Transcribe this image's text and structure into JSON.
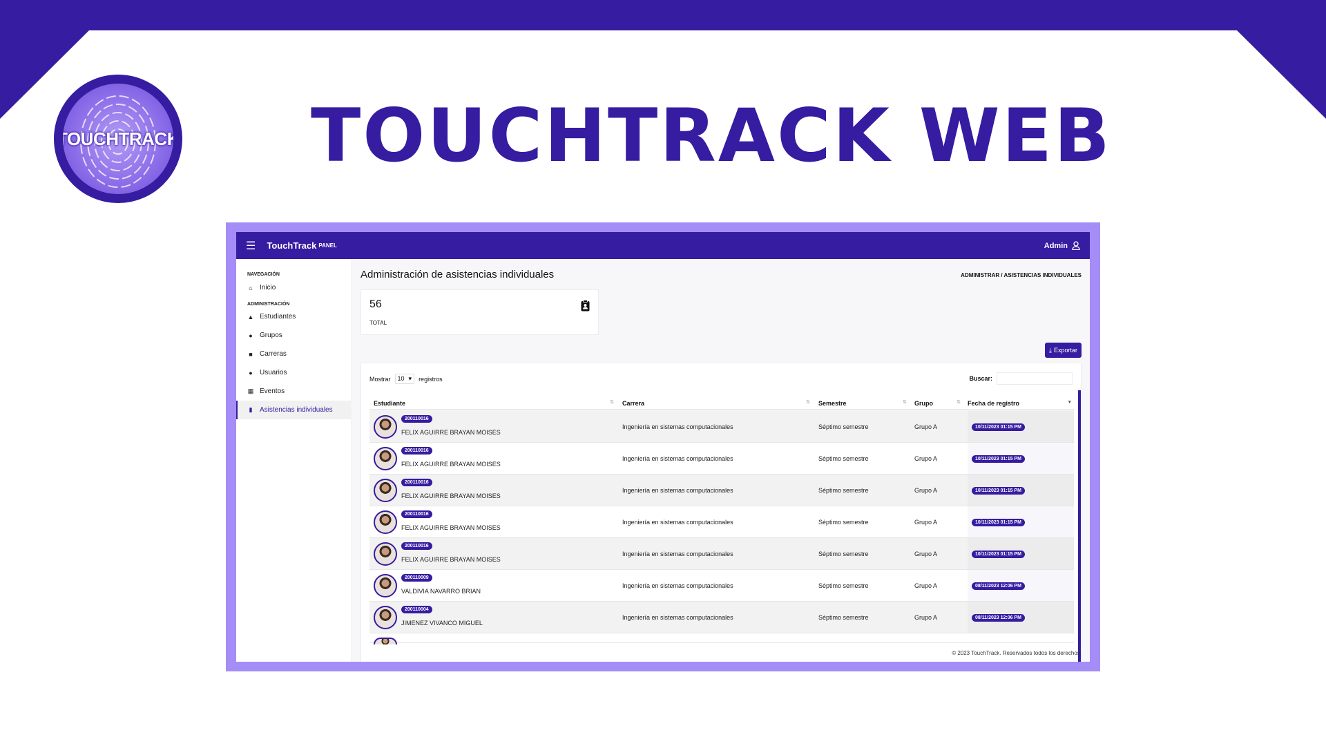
{
  "hero": {
    "title": "TOUCHTRACK WEB",
    "logo_text": "TOUCHTRACK"
  },
  "navbar": {
    "brand": "TouchTrack",
    "brand_small": "PANEL",
    "user": "Admin"
  },
  "sidebar": {
    "section_nav": "NAVEGACIÓN",
    "nav_items": [
      {
        "label": "Inicio",
        "icon": "home-icon"
      }
    ],
    "section_admin": "ADMINISTRACIÓN",
    "admin_items": [
      {
        "label": "Estudiantes",
        "icon": "graduation-cap-icon"
      },
      {
        "label": "Grupos",
        "icon": "people-group-icon"
      },
      {
        "label": "Carreras",
        "icon": "building-icon"
      },
      {
        "label": "Usuarios",
        "icon": "users-icon"
      },
      {
        "label": "Eventos",
        "icon": "calendar-icon"
      },
      {
        "label": "Asistencias individuales",
        "icon": "clipboard-user-icon",
        "active": true
      }
    ]
  },
  "main": {
    "title": "Administración de asistencias individuales",
    "breadcrumb": "ADMINISTRAR / ASISTENCIAS INDIVIDUALES",
    "stat": {
      "value": "56",
      "label": "TOTAL"
    },
    "export_label": "Exportar",
    "table": {
      "show_label": "Mostrar",
      "show_value": "10",
      "records_label": "registros",
      "search_label": "Buscar:",
      "columns": [
        "Estudiante",
        "Carrera",
        "Semestre",
        "Grupo",
        "Fecha de registro"
      ],
      "rows": [
        {
          "id": "200110016",
          "name": "FELIX AGUIRRE BRAYAN MOISES",
          "carrera": "Ingeniería en sistemas computacionales",
          "semestre": "Séptimo semestre",
          "grupo": "Grupo A",
          "fecha": "10/11/2023 01:15 PM"
        },
        {
          "id": "200110016",
          "name": "FELIX AGUIRRE BRAYAN MOISES",
          "carrera": "Ingeniería en sistemas computacionales",
          "semestre": "Séptimo semestre",
          "grupo": "Grupo A",
          "fecha": "10/11/2023 01:15 PM"
        },
        {
          "id": "200110016",
          "name": "FELIX AGUIRRE BRAYAN MOISES",
          "carrera": "Ingeniería en sistemas computacionales",
          "semestre": "Séptimo semestre",
          "grupo": "Grupo A",
          "fecha": "10/11/2023 01:15 PM"
        },
        {
          "id": "200110016",
          "name": "FELIX AGUIRRE BRAYAN MOISES",
          "carrera": "Ingeniería en sistemas computacionales",
          "semestre": "Séptimo semestre",
          "grupo": "Grupo A",
          "fecha": "10/11/2023 01:15 PM"
        },
        {
          "id": "200110016",
          "name": "FELIX AGUIRRE BRAYAN MOISES",
          "carrera": "Ingeniería en sistemas computacionales",
          "semestre": "Séptimo semestre",
          "grupo": "Grupo A",
          "fecha": "10/11/2023 01:15 PM"
        },
        {
          "id": "200110009",
          "name": "VALDIVIA NAVARRO BRIAN",
          "carrera": "Ingeniería en sistemas computacionales",
          "semestre": "Séptimo semestre",
          "grupo": "Grupo A",
          "fecha": "08/11/2023 12:06 PM"
        },
        {
          "id": "200110004",
          "name": "JIMENEZ VIVANCO MIGUEL",
          "carrera": "Ingeniería en sistemas computacionales",
          "semestre": "Séptimo semestre",
          "grupo": "Grupo A",
          "fecha": "08/11/2023 12:06 PM"
        }
      ]
    },
    "footer": "© 2023 TouchTrack. Reservados todos los derechos."
  }
}
